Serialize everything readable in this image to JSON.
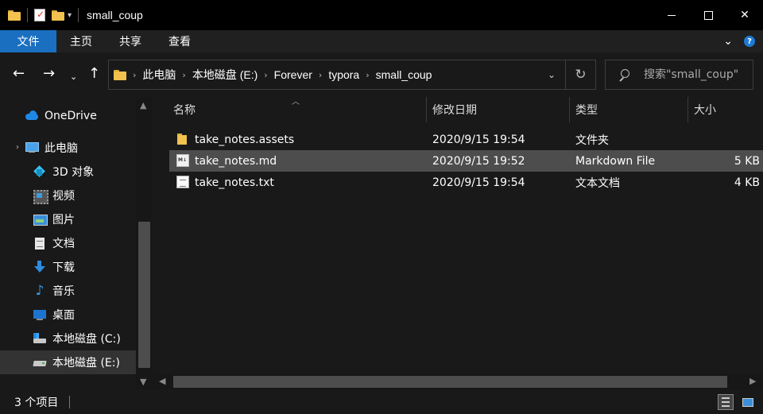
{
  "window": {
    "title": "small_coup"
  },
  "ribbon": {
    "tabs": [
      "文件",
      "主页",
      "共享",
      "查看"
    ]
  },
  "address": {
    "crumbs": [
      "此电脑",
      "本地磁盘 (E:)",
      "Forever",
      "typora",
      "small_coup"
    ]
  },
  "search": {
    "placeholder": "搜索\"small_coup\""
  },
  "nav": {
    "items": [
      {
        "label": "OneDrive",
        "icon": "cloud-icon"
      },
      {
        "label": "此电脑",
        "icon": "computer-icon"
      },
      {
        "label": "3D 对象",
        "icon": "cube-icon"
      },
      {
        "label": "视频",
        "icon": "video-icon"
      },
      {
        "label": "图片",
        "icon": "picture-icon"
      },
      {
        "label": "文档",
        "icon": "document-icon"
      },
      {
        "label": "下载",
        "icon": "download-icon"
      },
      {
        "label": "音乐",
        "icon": "music-icon"
      },
      {
        "label": "桌面",
        "icon": "desktop-icon"
      },
      {
        "label": "本地磁盘 (C:)",
        "icon": "drive-c-icon"
      },
      {
        "label": "本地磁盘 (E:)",
        "icon": "drive-e-icon"
      }
    ]
  },
  "table": {
    "columns": [
      "名称",
      "修改日期",
      "类型",
      "大小"
    ],
    "rows": [
      {
        "name": "take_notes.assets",
        "date": "2020/9/15 19:54",
        "type": "文件夹",
        "size": "",
        "icon": "folder-icon"
      },
      {
        "name": "take_notes.md",
        "date": "2020/9/15 19:52",
        "type": "Markdown File",
        "size": "5 KB",
        "icon": "markdown-file-icon"
      },
      {
        "name": "take_notes.txt",
        "date": "2020/9/15 19:54",
        "type": "文本文档",
        "size": "4 KB",
        "icon": "text-file-icon"
      }
    ]
  },
  "status": {
    "count": "3 个项目"
  },
  "colors": {
    "accent": "#1a6fc0",
    "background": "#191919",
    "selected_row": "#4d4d4d"
  }
}
